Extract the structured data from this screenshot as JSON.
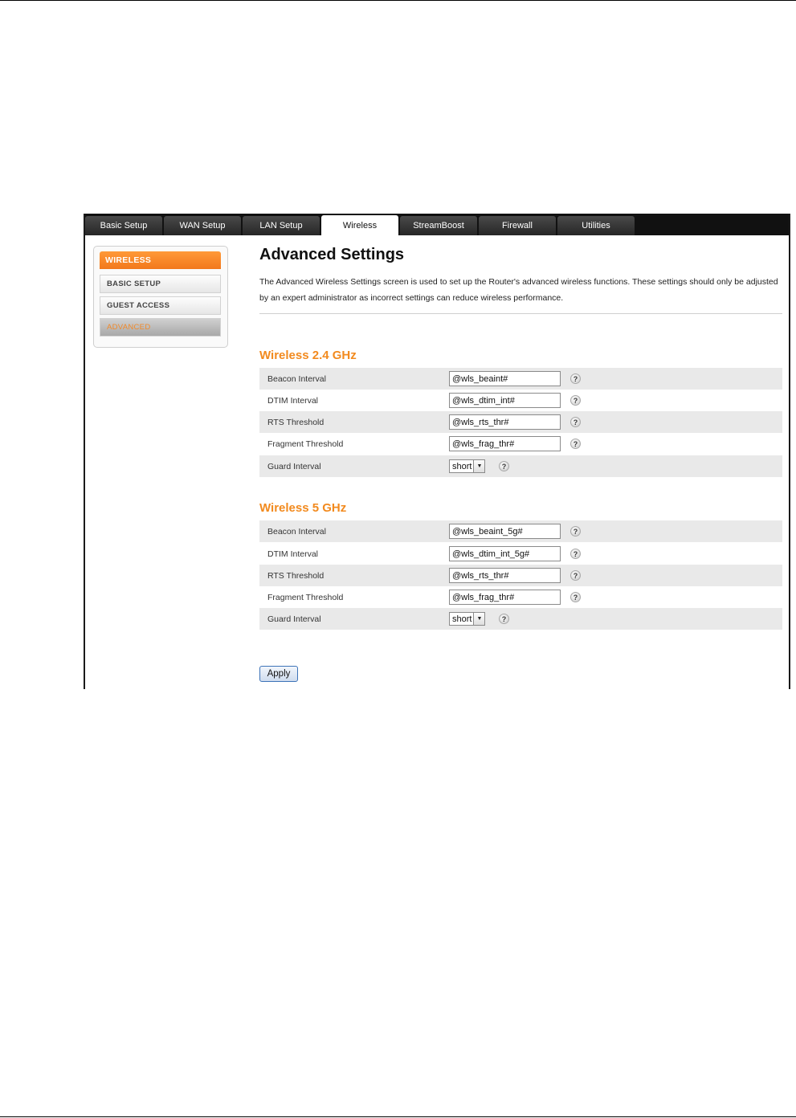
{
  "tabs": [
    {
      "label": "Basic Setup",
      "active": false
    },
    {
      "label": "WAN Setup",
      "active": false
    },
    {
      "label": "LAN Setup",
      "active": false
    },
    {
      "label": "Wireless",
      "active": true
    },
    {
      "label": "StreamBoost",
      "active": false
    },
    {
      "label": "Firewall",
      "active": false
    },
    {
      "label": "Utilities",
      "active": false
    }
  ],
  "sidebar": {
    "header": "WIRELESS",
    "items": [
      {
        "label": "BASIC SETUP",
        "active": false
      },
      {
        "label": "GUEST ACCESS",
        "active": false
      },
      {
        "label": "ADVANCED",
        "active": true
      }
    ]
  },
  "main": {
    "title": "Advanced Settings",
    "description": "The Advanced Wireless Settings screen is used to set up the Router's advanced wireless functions. These settings should only be adjusted by an expert administrator as incorrect settings can reduce wireless performance.",
    "sections": [
      {
        "title": "Wireless 2.4 GHz",
        "rows": [
          {
            "label": "Beacon Interval",
            "value": "@wls_beaint#"
          },
          {
            "label": "DTIM Interval",
            "value": "@wls_dtim_int#"
          },
          {
            "label": "RTS Threshold",
            "value": "@wls_rts_thr#"
          },
          {
            "label": "Fragment Threshold",
            "value": "@wls_frag_thr#"
          },
          {
            "label": "Guard Interval",
            "select_value": "short"
          }
        ]
      },
      {
        "title": "Wireless 5 GHz",
        "rows": [
          {
            "label": "Beacon Interval",
            "value": "@wls_beaint_5g#"
          },
          {
            "label": "DTIM Interval",
            "value": "@wls_dtim_int_5g#"
          },
          {
            "label": "RTS Threshold",
            "value": "@wls_rts_thr#"
          },
          {
            "label": "Fragment Threshold",
            "value": "@wls_frag_thr#"
          },
          {
            "label": "Guard Interval",
            "select_value": "short"
          }
        ]
      }
    ],
    "help_glyph": "?",
    "apply_label": "Apply"
  },
  "colors": {
    "accent": "#f28a1e",
    "tab_bar": "#111111",
    "row_shade": "#e9e9e9"
  }
}
